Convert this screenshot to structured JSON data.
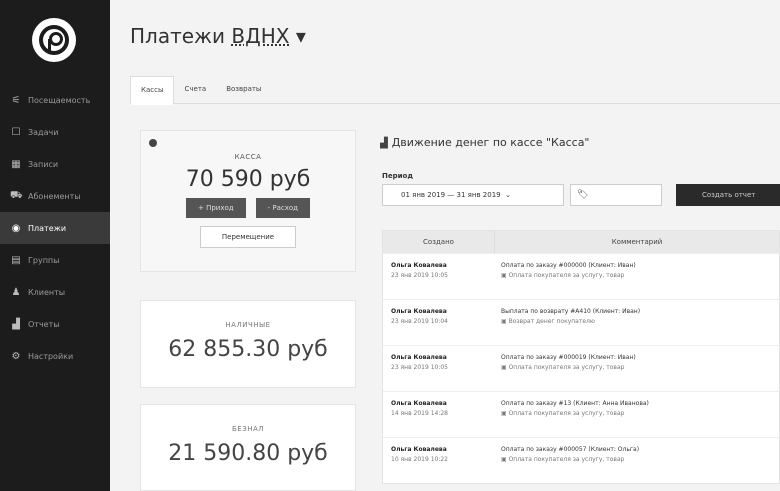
{
  "sidebar": {
    "items": [
      {
        "label": "Посещаемость",
        "icon": "sliders-icon"
      },
      {
        "label": "Задачи",
        "icon": "tasks-icon"
      },
      {
        "label": "Записи",
        "icon": "calendar-icon"
      },
      {
        "label": "Абонементы",
        "icon": "cart-icon"
      },
      {
        "label": "Платежи",
        "icon": "money-icon",
        "active": true
      },
      {
        "label": "Группы",
        "icon": "groups-icon"
      },
      {
        "label": "Клиенты",
        "icon": "user-icon"
      },
      {
        "label": "Отчеты",
        "icon": "chart-icon"
      },
      {
        "label": "Настройки",
        "icon": "gear-icon"
      }
    ]
  },
  "header": {
    "title_prefix": "Платежи ",
    "title_place": "ВДНХ",
    "title_caret": " ▾"
  },
  "tabs": [
    "Кассы",
    "Счета",
    "Возвраты"
  ],
  "main_cash": {
    "caption": "КАССА",
    "amount": "70 590 руб",
    "income_label": "+ Приход",
    "expense_label": "- Расход",
    "transfer_label": "Перемещение"
  },
  "cash_card": {
    "caption": "НАЛИЧНЫЕ",
    "amount": "62 855.30 руб"
  },
  "cashless_card": {
    "caption": "БЕЗНАЛ",
    "amount": "21 590.80 руб"
  },
  "panel": {
    "title": "Движение денег по кассе \"Касса\"",
    "period_label": "Период",
    "date_range": "01 янв 2019 — 31 янв 2019",
    "create_button": "Создать отчет",
    "columns": [
      "Создано",
      "Комментарий"
    ],
    "rows": [
      {
        "who": "Ольга Ковалева",
        "when": "23 янв 2019 10:05",
        "comment": "Оплата по заказу #000000 (Клиент: Иван)",
        "sub": "Оплата покупателя за услугу, товар"
      },
      {
        "who": "Ольга Ковалева",
        "when": "23 янв 2019 10:04",
        "comment": "Выплата по возврату #А410 (Клиент: Иван)",
        "sub": "Возврат денег покупателю"
      },
      {
        "who": "Ольга Ковалева",
        "when": "23 янв 2019 10:05",
        "comment": "Оплата по заказу #000019 (Клиент: Иван)",
        "sub": "Оплата покупателя за услугу, товар"
      },
      {
        "who": "Ольга Ковалева",
        "when": "14 янв 2019 14:28",
        "comment": "Оплата по заказу #13 (Клиент: Анна Иванова)",
        "sub": "Оплата покупателя за услугу, товар"
      },
      {
        "who": "Ольга Ковалева",
        "when": "10 янв 2019 10:22",
        "comment": "Оплата по заказу #000057 (Клиент: Ольга)",
        "sub": "Оплата покупателя за услугу, товар"
      }
    ]
  }
}
